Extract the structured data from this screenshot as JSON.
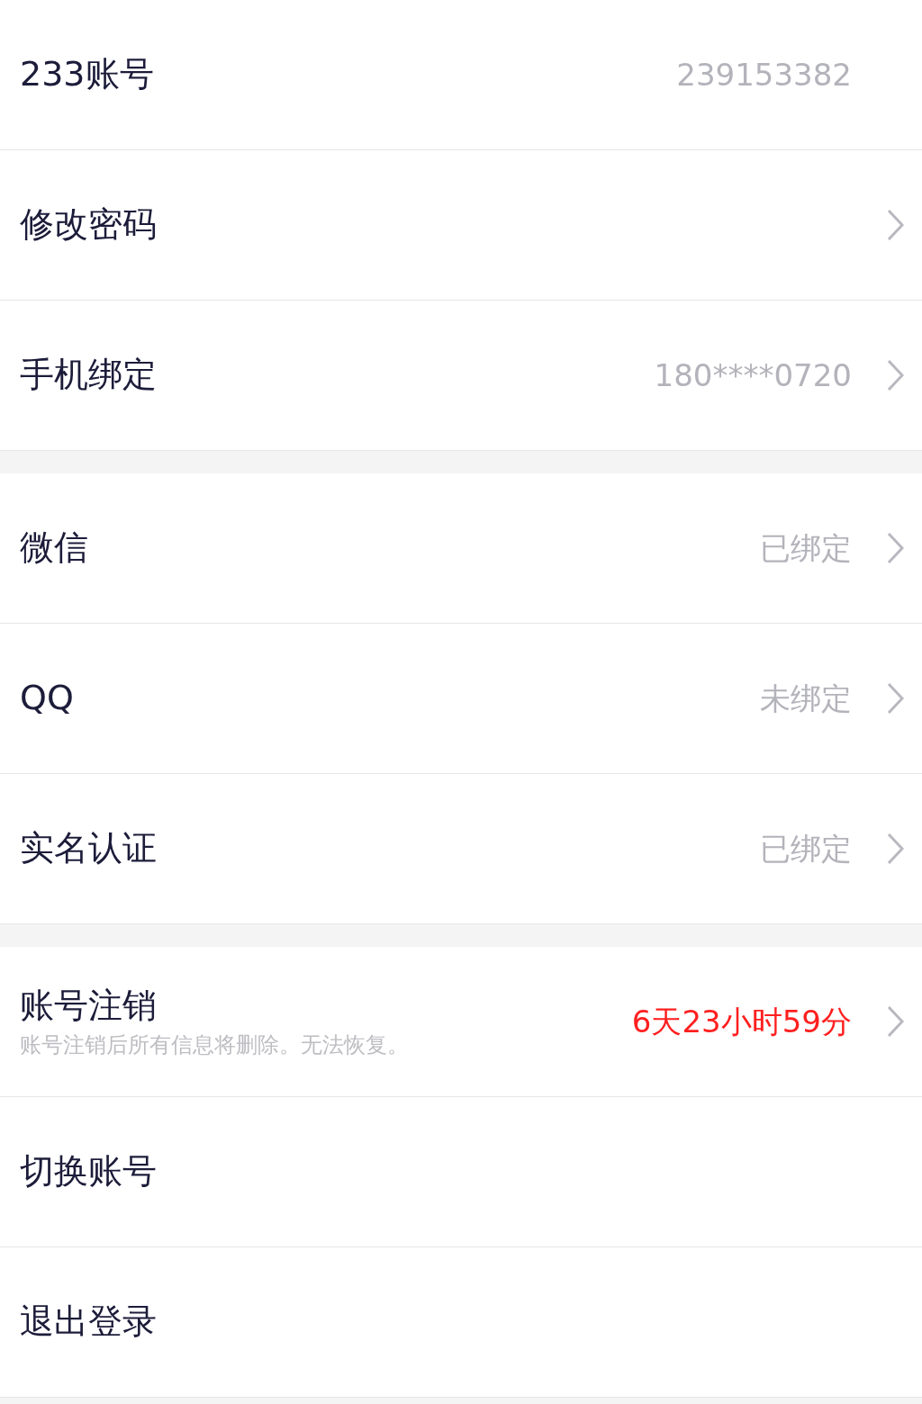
{
  "groups": [
    {
      "rows": [
        {
          "label": "233账号",
          "value": "239153382",
          "alert": false,
          "chevron": false
        },
        {
          "label": "修改密码",
          "chevron": true
        },
        {
          "label": "手机绑定",
          "value": "180****0720",
          "alert": false,
          "chevron": true
        }
      ]
    },
    {
      "rows": [
        {
          "label": "微信",
          "value": "已绑定",
          "alert": false,
          "chevron": true
        },
        {
          "label": "QQ",
          "value": "未绑定",
          "alert": false,
          "chevron": true
        },
        {
          "label": "实名认证",
          "value": "已绑定",
          "alert": false,
          "chevron": true
        }
      ]
    },
    {
      "rows": [
        {
          "label": "账号注销",
          "note": "账号注销后所有信息将删除。无法恢复。",
          "value": "6天23小时59分",
          "alert": true,
          "chevron": true
        },
        {
          "label": "切换账号",
          "chevron": false
        },
        {
          "label": "退出登录",
          "chevron": false
        }
      ]
    }
  ]
}
